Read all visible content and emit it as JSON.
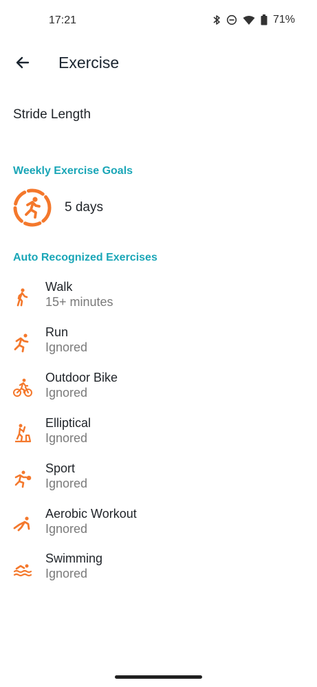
{
  "status": {
    "time": "17:21",
    "battery": "71%",
    "icons": [
      "bluetooth-icon",
      "do-not-disturb-icon",
      "wifi-icon",
      "battery-icon"
    ]
  },
  "header": {
    "title": "Exercise",
    "back_icon": "arrow-left-icon"
  },
  "settings": {
    "stride_length": "Stride Length"
  },
  "weekly_goals": {
    "header": "Weekly Exercise Goals",
    "value": "5 days",
    "icon": "running-goal-ring-icon"
  },
  "auto_recognized": {
    "header": "Auto Recognized Exercises",
    "items": [
      {
        "title": "Walk",
        "subtitle": "15+ minutes",
        "icon": "walk-icon"
      },
      {
        "title": "Run",
        "subtitle": "Ignored",
        "icon": "run-icon"
      },
      {
        "title": "Outdoor Bike",
        "subtitle": "Ignored",
        "icon": "bike-icon"
      },
      {
        "title": "Elliptical",
        "subtitle": "Ignored",
        "icon": "elliptical-icon"
      },
      {
        "title": "Sport",
        "subtitle": "Ignored",
        "icon": "sport-icon"
      },
      {
        "title": "Aerobic Workout",
        "subtitle": "Ignored",
        "icon": "aerobic-icon"
      },
      {
        "title": "Swimming",
        "subtitle": "Ignored",
        "icon": "swim-icon"
      }
    ]
  },
  "colors": {
    "accent": "#1aa6b7",
    "exercise_orange": "#f4782c",
    "title_text": "#1b2530",
    "secondary_text": "#7a7a7a"
  }
}
